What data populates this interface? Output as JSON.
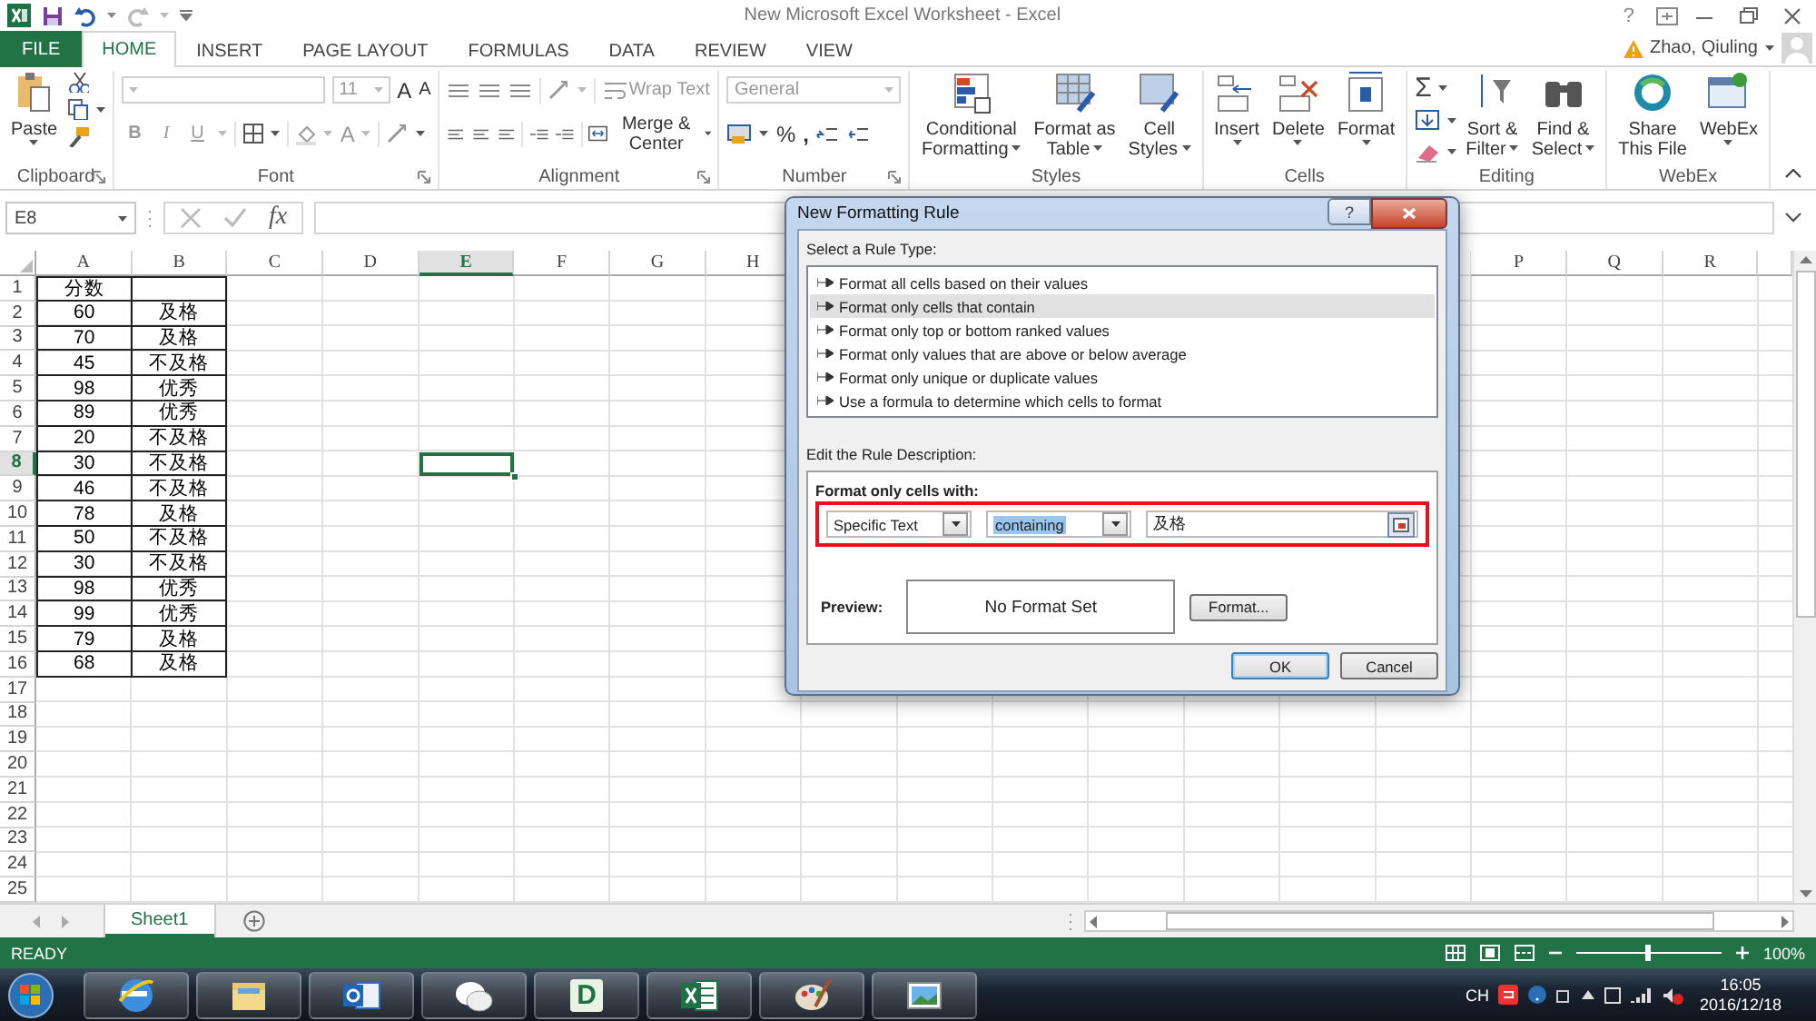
{
  "title_bar": {
    "title": "New Microsoft Excel Worksheet - Excel",
    "help": "?"
  },
  "ribbon_tabs": [
    {
      "label": "FILE",
      "kind": "file",
      "selected": false
    },
    {
      "label": "HOME",
      "kind": "tab",
      "selected": true
    },
    {
      "label": "INSERT",
      "kind": "tab",
      "selected": false
    },
    {
      "label": "PAGE LAYOUT",
      "kind": "tab",
      "selected": false
    },
    {
      "label": "FORMULAS",
      "kind": "tab",
      "selected": false
    },
    {
      "label": "DATA",
      "kind": "tab",
      "selected": false
    },
    {
      "label": "REVIEW",
      "kind": "tab",
      "selected": false
    },
    {
      "label": "VIEW",
      "kind": "tab",
      "selected": false
    }
  ],
  "user": {
    "name": "Zhao, Qiuling"
  },
  "ribbon_groups": [
    {
      "kind": "clipboard",
      "label": "Clipboard",
      "launcher": true,
      "buttons": [
        {
          "lines": [
            "Paste"
          ],
          "dropdown": true
        }
      ]
    },
    {
      "kind": "font",
      "label": "Font",
      "launcher": true,
      "font_size": "11",
      "grow": "A",
      "shrink": "A",
      "style_buttons": [
        "B",
        "I",
        "U"
      ],
      "font_color": "A"
    },
    {
      "kind": "alignment",
      "label": "Alignment",
      "launcher": true,
      "wrap_text": {
        "label": "Wrap Text",
        "disabled": true
      },
      "merge": {
        "label": "Merge & Center",
        "disabled": false
      }
    },
    {
      "kind": "number",
      "label": "Number",
      "launcher": true,
      "format": {
        "label": "General",
        "disabled": true
      },
      "percent": "%",
      "comma": ","
    },
    {
      "kind": "large",
      "label": "Styles",
      "launcher": false,
      "buttons": [
        {
          "lines": [
            "Conditional",
            "Formatting"
          ],
          "dropdown": true
        },
        {
          "lines": [
            "Format as",
            "Table"
          ],
          "dropdown": true
        },
        {
          "lines": [
            "Cell",
            "Styles"
          ],
          "dropdown": true
        }
      ]
    },
    {
      "kind": "large",
      "label": "Cells",
      "launcher": false,
      "buttons": [
        {
          "lines": [
            "Insert"
          ],
          "dropdown": true
        },
        {
          "lines": [
            "Delete"
          ],
          "dropdown": true
        },
        {
          "lines": [
            "Format"
          ],
          "dropdown": true
        }
      ]
    },
    {
      "kind": "editing",
      "label": "Editing",
      "launcher": false,
      "autosum": "Σ",
      "buttons": [
        {
          "lines": [
            "Sort &",
            "Filter"
          ],
          "dropdown": true
        },
        {
          "lines": [
            "Find &",
            "Select"
          ],
          "dropdown": true
        }
      ]
    },
    {
      "kind": "large",
      "label": "WebEx",
      "launcher": false,
      "buttons": [
        {
          "lines": [
            "Share",
            "This File"
          ],
          "dropdown": false
        },
        {
          "lines": [
            "WebEx"
          ],
          "dropdown": true
        }
      ]
    }
  ],
  "formula_bar": {
    "name_box": "E8",
    "fx": "fx"
  },
  "sheet": {
    "columns": [
      {
        "label": "A",
        "selected": false
      },
      {
        "label": "B",
        "selected": false
      },
      {
        "label": "C",
        "selected": false
      },
      {
        "label": "D",
        "selected": false
      },
      {
        "label": "E",
        "selected": true
      },
      {
        "label": "F",
        "selected": false
      },
      {
        "label": "G",
        "selected": false
      },
      {
        "label": "H",
        "selected": false
      },
      {
        "label": "P",
        "selected": false
      },
      {
        "label": "Q",
        "selected": false
      },
      {
        "label": "R",
        "selected": false
      }
    ],
    "rows": [
      {
        "label": "1",
        "selected": false,
        "cells": [
          "分数"
        ]
      },
      {
        "label": "2",
        "selected": false,
        "cells": [
          "60",
          "及格"
        ]
      },
      {
        "label": "3",
        "selected": false,
        "cells": [
          "70",
          "及格"
        ]
      },
      {
        "label": "4",
        "selected": false,
        "cells": [
          "45",
          "不及格"
        ]
      },
      {
        "label": "5",
        "selected": false,
        "cells": [
          "98",
          "优秀"
        ]
      },
      {
        "label": "6",
        "selected": false,
        "cells": [
          "89",
          "优秀"
        ]
      },
      {
        "label": "7",
        "selected": false,
        "cells": [
          "20",
          "不及格"
        ]
      },
      {
        "label": "8",
        "selected": true,
        "cells": [
          "30",
          "不及格"
        ]
      },
      {
        "label": "9",
        "selected": false,
        "cells": [
          "46",
          "不及格"
        ]
      },
      {
        "label": "10",
        "selected": false,
        "cells": [
          "78",
          "及格"
        ]
      },
      {
        "label": "11",
        "selected": false,
        "cells": [
          "50",
          "不及格"
        ]
      },
      {
        "label": "12",
        "selected": false,
        "cells": [
          "30",
          "不及格"
        ]
      },
      {
        "label": "13",
        "selected": false,
        "cells": [
          "98",
          "优秀"
        ]
      },
      {
        "label": "14",
        "selected": false,
        "cells": [
          "99",
          "优秀"
        ]
      },
      {
        "label": "15",
        "selected": false,
        "cells": [
          "79",
          "及格"
        ]
      },
      {
        "label": "16",
        "selected": false,
        "cells": [
          "68",
          "及格"
        ]
      },
      {
        "label": "17",
        "selected": false
      },
      {
        "label": "18",
        "selected": false
      },
      {
        "label": "19",
        "selected": false
      },
      {
        "label": "20",
        "selected": false
      },
      {
        "label": "21",
        "selected": false
      },
      {
        "label": "22",
        "selected": false
      },
      {
        "label": "23",
        "selected": false
      },
      {
        "label": "24",
        "selected": false
      },
      {
        "label": "25",
        "selected": false
      }
    ]
  },
  "sheet_tabs": [
    {
      "label": "Sheet1",
      "selected": true
    }
  ],
  "status_bar": {
    "status": "READY",
    "zoom_label": "100%",
    "zoom": {
      "level": 0.5
    }
  },
  "taskbar": {
    "apps": [
      {
        "kind": "browser"
      },
      {
        "kind": "folder"
      },
      {
        "kind": "mail"
      },
      {
        "kind": "chat"
      },
      {
        "kind": "letter",
        "letter": "D"
      },
      {
        "kind": "spreadsheet"
      },
      {
        "kind": "paint"
      },
      {
        "kind": "photos"
      }
    ],
    "language": "CH",
    "time": "16:05",
    "date": "2016/12/18"
  },
  "dialog": {
    "title": "New Formatting Rule",
    "help": "?",
    "rule_type_label": "Select a Rule Type:",
    "rule_types": [
      {
        "label": "Format all cells based on their values",
        "selected": false
      },
      {
        "label": "Format only cells that contain",
        "selected": true
      },
      {
        "label": "Format only top or bottom ranked values",
        "selected": false
      },
      {
        "label": "Format only values that are above or below average",
        "selected": false
      },
      {
        "label": "Format only unique or duplicate values",
        "selected": false
      },
      {
        "label": "Use a formula to determine which cells to format",
        "selected": false
      }
    ],
    "description_label": "Edit the Rule Description:",
    "condition_label": "Format only cells with:",
    "condition_type": "Specific Text",
    "operator": "containing",
    "value": "及格",
    "preview_label": "Preview:",
    "preview_text": "No Format Set",
    "buttons": [
      {
        "label": "Format...",
        "kind": "format"
      },
      {
        "label": "OK",
        "kind": "default"
      },
      {
        "label": "Cancel",
        "kind": "normal"
      }
    ]
  }
}
